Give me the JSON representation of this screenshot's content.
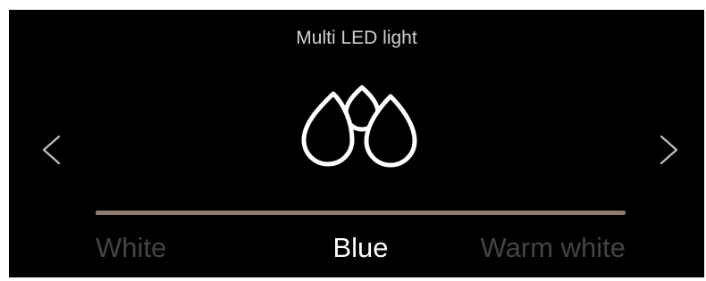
{
  "header": {
    "title": "Multi LED light"
  },
  "mode_icon": "water-drops-icon",
  "navigation": {
    "prev_icon": "chevron-left-icon",
    "next_icon": "chevron-right-icon"
  },
  "color_selector": {
    "options": [
      "White",
      "Blue",
      "Warm white"
    ],
    "selected": "Blue",
    "selected_index": 1
  },
  "colors": {
    "background": "#000000",
    "title_text": "#cfcfcf",
    "selected_text": "#ffffff",
    "unselected_text": "#444444",
    "track": "#8e7d6e",
    "icon_stroke": "#ffffff",
    "chevron": "#bfbfbf"
  }
}
